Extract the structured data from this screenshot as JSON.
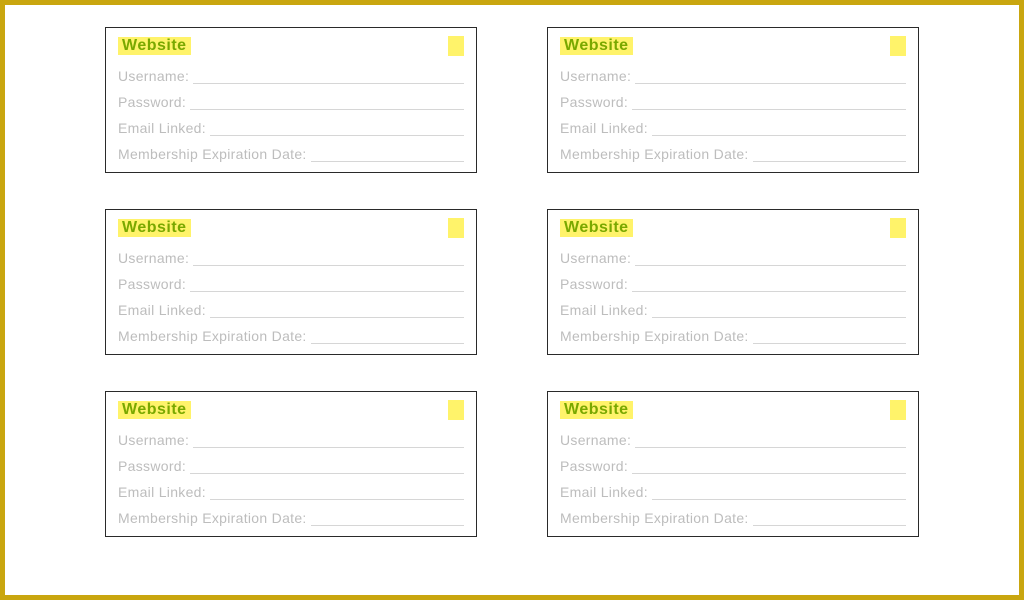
{
  "card": {
    "title": "Website",
    "fields": {
      "username": "Username:",
      "password": "Password:",
      "email": "Email Linked:",
      "expires": "Membership Expiration Date:"
    }
  }
}
